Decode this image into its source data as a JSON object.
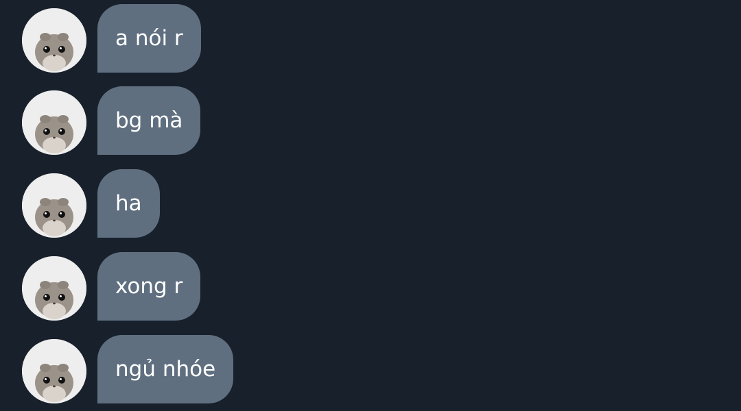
{
  "chat": {
    "messages": [
      {
        "text": "a nói r",
        "avatar_icon": "hamster-avatar-icon"
      },
      {
        "text": "bg mà",
        "avatar_icon": "hamster-avatar-icon"
      },
      {
        "text": "ha",
        "avatar_icon": "hamster-avatar-icon"
      },
      {
        "text": "xong r",
        "avatar_icon": "hamster-avatar-icon"
      },
      {
        "text": "ngủ nhóe",
        "avatar_icon": "hamster-avatar-icon"
      }
    ]
  },
  "theme": {
    "background": "#18202b",
    "bubble_color": "#5f6f80",
    "text_color": "#ffffff"
  }
}
